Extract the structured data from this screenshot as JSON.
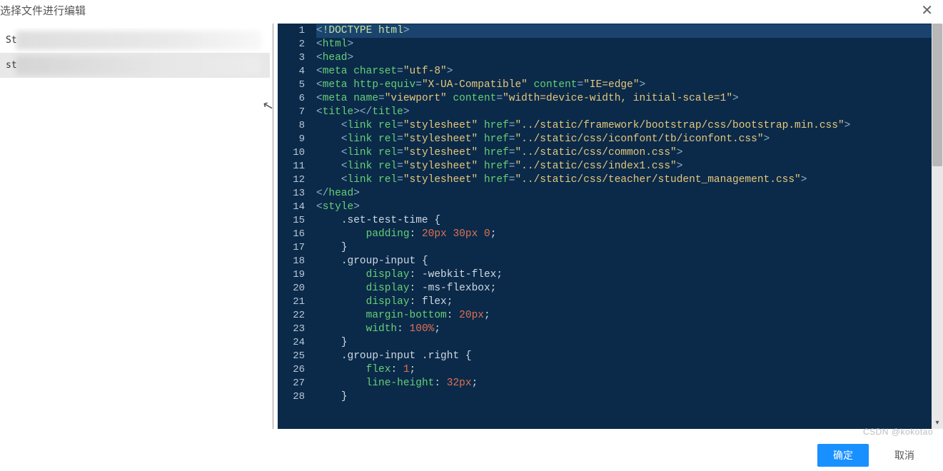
{
  "header": {
    "title": "选择文件进行编辑"
  },
  "sidebar": {
    "items": [
      {
        "prefix": "St"
      },
      {
        "prefix": "st"
      }
    ]
  },
  "editor": {
    "lines": [
      [
        [
          "bracket",
          "<"
        ],
        [
          "doctype",
          "!DOCTYPE html"
        ],
        [
          "bracket",
          ">"
        ]
      ],
      [
        [
          "bracket",
          "<"
        ],
        [
          "tag",
          "html"
        ],
        [
          "bracket",
          ">"
        ]
      ],
      [
        [
          "bracket",
          "<"
        ],
        [
          "tag",
          "head"
        ],
        [
          "bracket",
          ">"
        ]
      ],
      [
        [
          "bracket",
          "<"
        ],
        [
          "tag",
          "meta"
        ],
        [
          "text",
          " "
        ],
        [
          "attr",
          "charset"
        ],
        [
          "eq",
          "="
        ],
        [
          "str",
          "\"utf-8\""
        ],
        [
          "bracket",
          ">"
        ]
      ],
      [
        [
          "bracket",
          "<"
        ],
        [
          "tag",
          "meta"
        ],
        [
          "text",
          " "
        ],
        [
          "attr",
          "http-equiv"
        ],
        [
          "eq",
          "="
        ],
        [
          "str",
          "\"X-UA-Compatible\""
        ],
        [
          "text",
          " "
        ],
        [
          "attr",
          "content"
        ],
        [
          "eq",
          "="
        ],
        [
          "str",
          "\"IE=edge\""
        ],
        [
          "bracket",
          ">"
        ]
      ],
      [
        [
          "bracket",
          "<"
        ],
        [
          "tag",
          "meta"
        ],
        [
          "text",
          " "
        ],
        [
          "attr",
          "name"
        ],
        [
          "eq",
          "="
        ],
        [
          "str",
          "\"viewport\""
        ],
        [
          "text",
          " "
        ],
        [
          "attr",
          "content"
        ],
        [
          "eq",
          "="
        ],
        [
          "str",
          "\"width=device-width, initial-scale=1\""
        ],
        [
          "bracket",
          ">"
        ]
      ],
      [
        [
          "bracket",
          "<"
        ],
        [
          "tag",
          "title"
        ],
        [
          "bracket",
          ">"
        ],
        [
          "bracket",
          "</"
        ],
        [
          "tag",
          "title"
        ],
        [
          "bracket",
          ">"
        ]
      ],
      [
        [
          "text",
          "    "
        ],
        [
          "bracket",
          "<"
        ],
        [
          "tag",
          "link"
        ],
        [
          "text",
          " "
        ],
        [
          "attr",
          "rel"
        ],
        [
          "eq",
          "="
        ],
        [
          "str",
          "\"stylesheet\""
        ],
        [
          "text",
          " "
        ],
        [
          "attr",
          "href"
        ],
        [
          "eq",
          "="
        ],
        [
          "str",
          "\"../static/framework/bootstrap/css/bootstrap.min.css\""
        ],
        [
          "bracket",
          ">"
        ]
      ],
      [
        [
          "text",
          "    "
        ],
        [
          "bracket",
          "<"
        ],
        [
          "tag",
          "link"
        ],
        [
          "text",
          " "
        ],
        [
          "attr",
          "rel"
        ],
        [
          "eq",
          "="
        ],
        [
          "str",
          "\"stylesheet\""
        ],
        [
          "text",
          " "
        ],
        [
          "attr",
          "href"
        ],
        [
          "eq",
          "="
        ],
        [
          "str",
          "\"../static/css/iconfont/tb/iconfont.css\""
        ],
        [
          "bracket",
          ">"
        ]
      ],
      [
        [
          "text",
          "    "
        ],
        [
          "bracket",
          "<"
        ],
        [
          "tag",
          "link"
        ],
        [
          "text",
          " "
        ],
        [
          "attr",
          "rel"
        ],
        [
          "eq",
          "="
        ],
        [
          "str",
          "\"stylesheet\""
        ],
        [
          "text",
          " "
        ],
        [
          "attr",
          "href"
        ],
        [
          "eq",
          "="
        ],
        [
          "str",
          "\"../static/css/common.css\""
        ],
        [
          "bracket",
          ">"
        ]
      ],
      [
        [
          "text",
          "    "
        ],
        [
          "bracket",
          "<"
        ],
        [
          "tag",
          "link"
        ],
        [
          "text",
          " "
        ],
        [
          "attr",
          "rel"
        ],
        [
          "eq",
          "="
        ],
        [
          "str",
          "\"stylesheet\""
        ],
        [
          "text",
          " "
        ],
        [
          "attr",
          "href"
        ],
        [
          "eq",
          "="
        ],
        [
          "str",
          "\"../static/css/index1.css\""
        ],
        [
          "bracket",
          ">"
        ]
      ],
      [
        [
          "text",
          "    "
        ],
        [
          "bracket",
          "<"
        ],
        [
          "tag",
          "link"
        ],
        [
          "text",
          " "
        ],
        [
          "attr",
          "rel"
        ],
        [
          "eq",
          "="
        ],
        [
          "str",
          "\"stylesheet\""
        ],
        [
          "text",
          " "
        ],
        [
          "attr",
          "href"
        ],
        [
          "eq",
          "="
        ],
        [
          "str",
          "\"../static/css/teacher/student_management.css\""
        ],
        [
          "bracket",
          ">"
        ]
      ],
      [
        [
          "bracket",
          "</"
        ],
        [
          "tag",
          "head"
        ],
        [
          "bracket",
          ">"
        ]
      ],
      [
        [
          "bracket",
          "<"
        ],
        [
          "tag",
          "style"
        ],
        [
          "bracket",
          ">"
        ]
      ],
      [
        [
          "text",
          "    "
        ],
        [
          "sel",
          ".set-test-time "
        ],
        [
          "punc",
          "{"
        ]
      ],
      [
        [
          "text",
          "        "
        ],
        [
          "prop",
          "padding"
        ],
        [
          "punc",
          ": "
        ],
        [
          "num",
          "20"
        ],
        [
          "unit",
          "px"
        ],
        [
          "val",
          " "
        ],
        [
          "num",
          "30"
        ],
        [
          "unit",
          "px"
        ],
        [
          "val",
          " "
        ],
        [
          "num",
          "0"
        ],
        [
          "punc",
          ";"
        ]
      ],
      [
        [
          "text",
          "    "
        ],
        [
          "punc",
          "}"
        ]
      ],
      [
        [
          "text",
          "    "
        ],
        [
          "sel",
          ".group-input "
        ],
        [
          "punc",
          "{"
        ]
      ],
      [
        [
          "text",
          "        "
        ],
        [
          "prop",
          "display"
        ],
        [
          "punc",
          ": "
        ],
        [
          "val",
          "-webkit-flex"
        ],
        [
          "punc",
          ";"
        ]
      ],
      [
        [
          "text",
          "        "
        ],
        [
          "prop",
          "display"
        ],
        [
          "punc",
          ": "
        ],
        [
          "val",
          "-ms-flexbox"
        ],
        [
          "punc",
          ";"
        ]
      ],
      [
        [
          "text",
          "        "
        ],
        [
          "prop",
          "display"
        ],
        [
          "punc",
          ": "
        ],
        [
          "val",
          "flex"
        ],
        [
          "punc",
          ";"
        ]
      ],
      [
        [
          "text",
          "        "
        ],
        [
          "prop",
          "margin-bottom"
        ],
        [
          "punc",
          ": "
        ],
        [
          "num",
          "20"
        ],
        [
          "unit",
          "px"
        ],
        [
          "punc",
          ";"
        ]
      ],
      [
        [
          "text",
          "        "
        ],
        [
          "prop",
          "width"
        ],
        [
          "punc",
          ": "
        ],
        [
          "num",
          "100"
        ],
        [
          "unit",
          "%"
        ],
        [
          "punc",
          ";"
        ]
      ],
      [
        [
          "text",
          "    "
        ],
        [
          "punc",
          "}"
        ]
      ],
      [
        [
          "text",
          "    "
        ],
        [
          "sel",
          ".group-input .right "
        ],
        [
          "punc",
          "{"
        ]
      ],
      [
        [
          "text",
          "        "
        ],
        [
          "prop",
          "flex"
        ],
        [
          "punc",
          ": "
        ],
        [
          "num",
          "1"
        ],
        [
          "punc",
          ";"
        ]
      ],
      [
        [
          "text",
          "        "
        ],
        [
          "prop",
          "line-height"
        ],
        [
          "punc",
          ": "
        ],
        [
          "num",
          "32"
        ],
        [
          "unit",
          "px"
        ],
        [
          "punc",
          ";"
        ]
      ],
      [
        [
          "text",
          "    "
        ],
        [
          "punc",
          "}"
        ]
      ]
    ],
    "highlight_line": 1
  },
  "footer": {
    "ok_label": "确定",
    "cancel_label": "取消"
  },
  "watermark": "CSDN @kokotao"
}
